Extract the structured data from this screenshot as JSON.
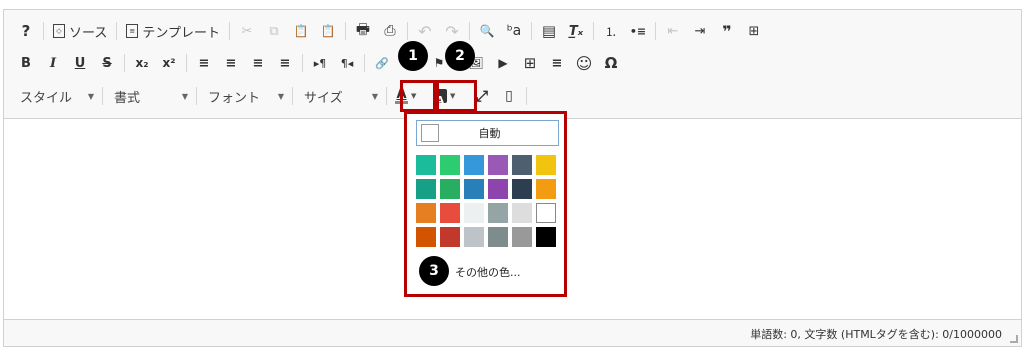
{
  "toolbar": {
    "row1": {
      "help": "?",
      "source_label": "ソース",
      "template_label": "テンプレート",
      "cut": "✂",
      "copy": "⧉",
      "paste": "📋",
      "paste_text": "📋",
      "print": "🖶",
      "find_page": "⎙",
      "undo": "↶",
      "redo": "↷",
      "find": "🔍",
      "replace": "ᵇa",
      "remove_format_block": "▤",
      "remove_format": "T̲ₓ",
      "numbered_list": "⒈",
      "bullet_list": "•≡",
      "outdent": "⇤",
      "indent": "⇥",
      "blockquote": "❞",
      "div": "⊞"
    },
    "row2": {
      "bold": "B",
      "italic": "I",
      "underline": "U",
      "strike": "S",
      "subscript": "x₂",
      "superscript": "x²",
      "align_left": "≡",
      "align_center": "≡",
      "align_right": "≡",
      "justify": "≡",
      "ltr": "▸¶",
      "rtl": "¶◂",
      "link": "🔗",
      "unlink": "⛓",
      "anchor": "⚑",
      "image": "🖼",
      "media": "▶",
      "table": "⊞",
      "hr": "≡",
      "smiley": "☺",
      "special_char": "Ω"
    },
    "row3": {
      "style_label": "スタイル",
      "format_label": "書式",
      "font_label": "フォント",
      "size_label": "サイズ",
      "text_color_glyph": "A",
      "bg_color_glyph": "A",
      "maximize": "⤢",
      "show_blocks": "▯"
    }
  },
  "badges": {
    "one": "1",
    "two": "2",
    "three": "3"
  },
  "color_panel": {
    "auto_label": "自動",
    "more_colors_label": "その他の色...",
    "colors": [
      "#1abc9c",
      "#2ecc71",
      "#3498db",
      "#9b59b6",
      "#4e5f70",
      "#f1c40f",
      "#16a085",
      "#27ae60",
      "#2980b9",
      "#8e44ad",
      "#2c3e50",
      "#f39c12",
      "#e67e22",
      "#e74c3c",
      "#ecf0f1",
      "#95a5a6",
      "#dddddd",
      "#ffffff",
      "#d35400",
      "#c0392b",
      "#bdc3c7",
      "#7f8c8d",
      "#999999",
      "#000000"
    ]
  },
  "status": {
    "text": "単語数: 0, 文字数 (HTMLタグを含む): 0/1000000"
  },
  "colors": {
    "highlight": "#b40000",
    "text_color_bar": "#888888",
    "auto_border": "#7aa8cf"
  }
}
